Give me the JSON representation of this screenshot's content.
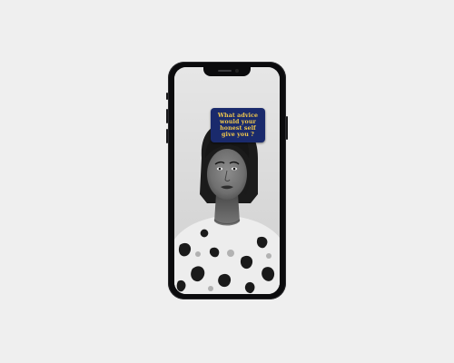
{
  "filter": {
    "prompt": "What advice would your honest self give you ?",
    "card_color": "#1a2a6c",
    "text_color": "#f2c94c"
  },
  "colors": {
    "background": "#efefef",
    "phone_frame": "#0b0b0d"
  },
  "icons": {
    "camera": "front-camera-icon",
    "speaker": "speaker-icon"
  }
}
